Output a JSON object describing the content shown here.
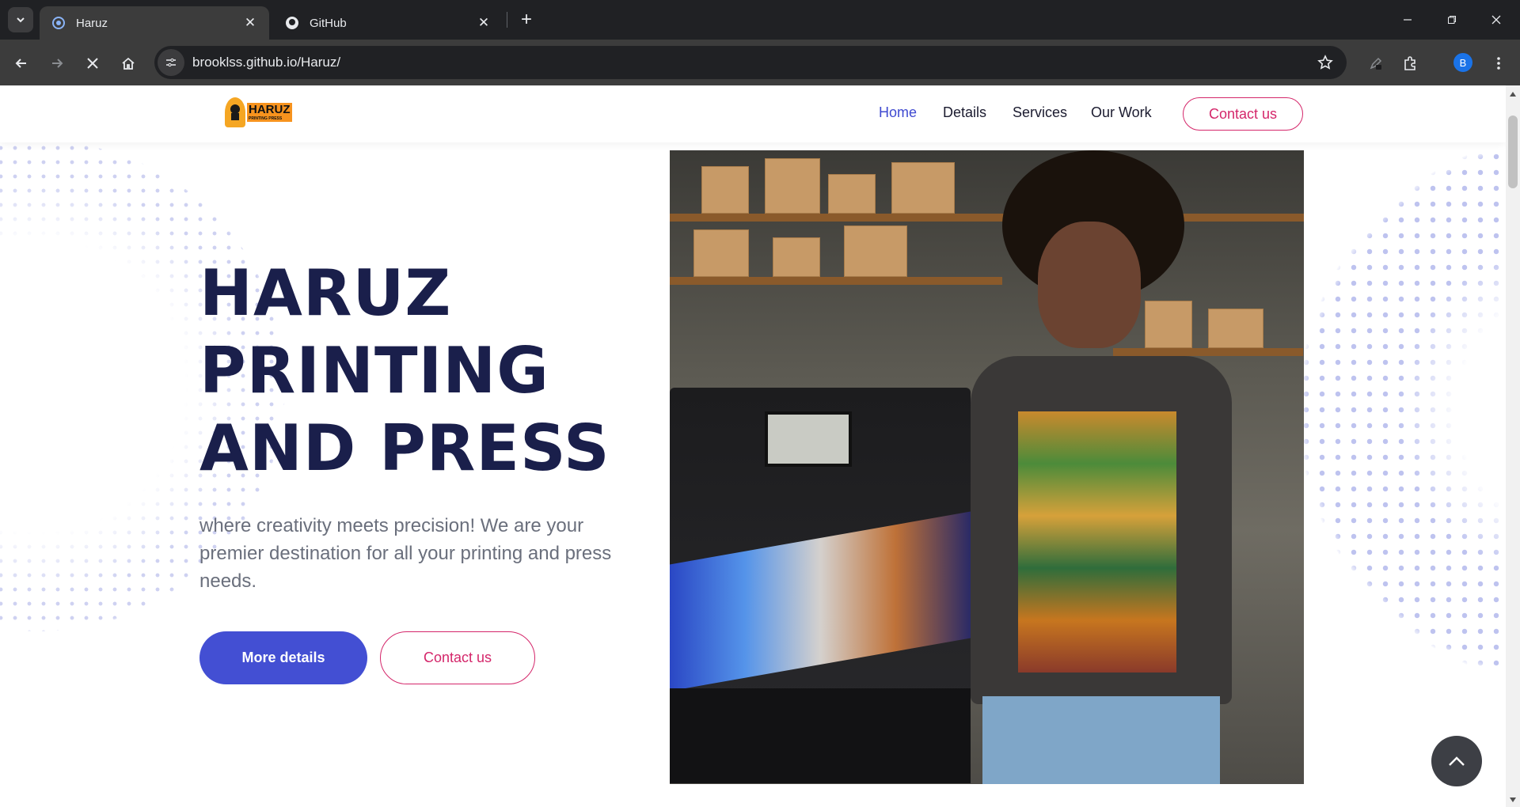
{
  "browser": {
    "tabs": [
      {
        "title": "Haruz",
        "active": true,
        "icon": "loading-spinner-icon"
      },
      {
        "title": "GitHub",
        "active": false,
        "icon": "github-icon"
      }
    ],
    "url": "brooklss.github.io/Haruz/",
    "profile_initial": "B"
  },
  "site": {
    "logo": {
      "big": "HARUZ",
      "small": "PRINTING PRESS"
    },
    "nav": {
      "home": "Home",
      "details": "Details",
      "services": "Services",
      "our_work": "Our Work",
      "contact": "Contact us"
    },
    "hero": {
      "title_line1": "HARUZ",
      "title_line2": "PRINTING",
      "title_line3": "AND PRESS",
      "text": "where creativity meets precision! We are your premier destination for all your printing and press needs.",
      "more_button": "More details",
      "contact_button": "Contact us"
    }
  },
  "colors": {
    "accent": "#434fd3",
    "nav_active": "#3f4ad0",
    "contact_accent": "#d4266a",
    "title": "#1a1f4b"
  }
}
